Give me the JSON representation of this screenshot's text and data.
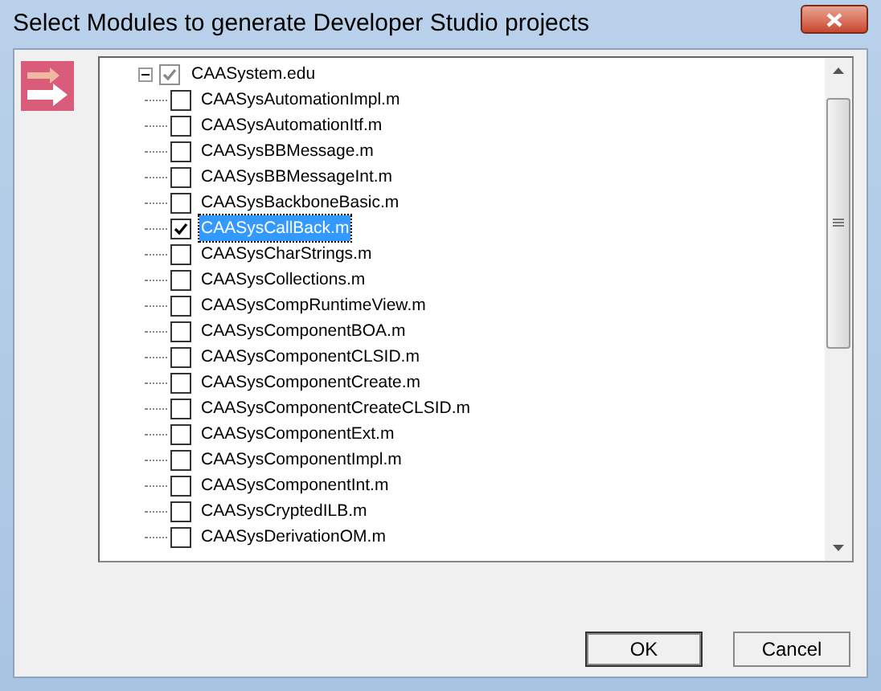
{
  "window": {
    "title": "Select Modules to generate Developer Studio projects"
  },
  "tree": {
    "label": "CAASystem.edu",
    "checked": true,
    "expanded": true,
    "children": [
      {
        "label": "CAASysAutomationImpl.m",
        "checked": false,
        "selected": false
      },
      {
        "label": "CAASysAutomationItf.m",
        "checked": false,
        "selected": false
      },
      {
        "label": "CAASysBBMessage.m",
        "checked": false,
        "selected": false
      },
      {
        "label": "CAASysBBMessageInt.m",
        "checked": false,
        "selected": false
      },
      {
        "label": "CAASysBackboneBasic.m",
        "checked": false,
        "selected": false
      },
      {
        "label": "CAASysCallBack.m",
        "checked": true,
        "selected": true
      },
      {
        "label": "CAASysCharStrings.m",
        "checked": false,
        "selected": false
      },
      {
        "label": "CAASysCollections.m",
        "checked": false,
        "selected": false
      },
      {
        "label": "CAASysCompRuntimeView.m",
        "checked": false,
        "selected": false
      },
      {
        "label": "CAASysComponentBOA.m",
        "checked": false,
        "selected": false
      },
      {
        "label": "CAASysComponentCLSID.m",
        "checked": false,
        "selected": false
      },
      {
        "label": "CAASysComponentCreate.m",
        "checked": false,
        "selected": false
      },
      {
        "label": "CAASysComponentCreateCLSID.m",
        "checked": false,
        "selected": false
      },
      {
        "label": "CAASysComponentExt.m",
        "checked": false,
        "selected": false
      },
      {
        "label": "CAASysComponentImpl.m",
        "checked": false,
        "selected": false
      },
      {
        "label": "CAASysComponentInt.m",
        "checked": false,
        "selected": false
      },
      {
        "label": "CAASysCryptedILB.m",
        "checked": false,
        "selected": false
      },
      {
        "label": "CAASysDerivationOM.m",
        "checked": false,
        "selected": false
      }
    ]
  },
  "buttons": [
    "OK",
    "Cancel"
  ]
}
